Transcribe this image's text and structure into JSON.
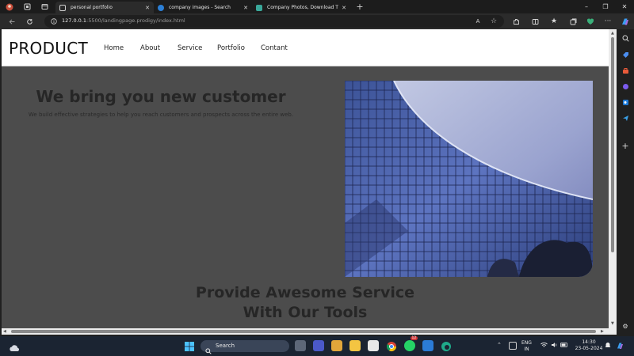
{
  "browser": {
    "tabs": [
      {
        "title": "personal portfolio",
        "active": true
      },
      {
        "title": "company images - Search",
        "active": false
      },
      {
        "title": "Company Photos, Download The",
        "active": false
      }
    ],
    "new_tab": "+",
    "url_host": "127.0.0.1",
    "url_path": ":5500/landingpage.prodigy/index.html",
    "window_controls": {
      "minimize": "–",
      "restore": "❐",
      "close": "✕"
    },
    "reader_badge": "A"
  },
  "site": {
    "logo": "PRODUCT",
    "menu": [
      "Home",
      "About",
      "Service",
      "Portfolio",
      "Contant"
    ],
    "hero": {
      "title": "We bring you new customer",
      "subtitle": "We build effective strategies to help you reach customers and prospects across the entire web."
    },
    "section": {
      "title_line1": "Provide Awesome Service",
      "title_line2": "With Our Tools"
    }
  },
  "taskbar": {
    "search_label": "Search",
    "lang_line1": "ENG",
    "lang_line2": "IN",
    "time": "14:30",
    "date": "23-05-2024",
    "badge_count": "12"
  },
  "colors": {
    "page_overlay": "#4c4c4c",
    "nav_bg": "#ffffff",
    "browser_bg": "#2b2b2b",
    "taskbar_bg": "#1b2432",
    "edge_blue": "#2b7fd6"
  }
}
